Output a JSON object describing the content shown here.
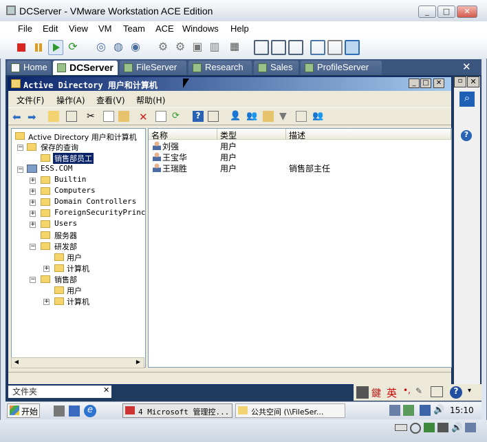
{
  "window": {
    "title": "DCServer - VMware Workstation ACE Edition"
  },
  "menu": [
    "File",
    "Edit",
    "View",
    "VM",
    "Team",
    "ACE",
    "Windows",
    "Help"
  ],
  "tabs": [
    {
      "label": "Home"
    },
    {
      "label": "DCServer"
    },
    {
      "label": "FileServer"
    },
    {
      "label": "Research"
    },
    {
      "label": "Sales"
    },
    {
      "label": "ProfileServer"
    }
  ],
  "mmc": {
    "title": "Active Directory 用户和计算机",
    "menu": [
      "文件(F)",
      "操作(A)",
      "查看(V)",
      "帮助(H)"
    ],
    "tree": [
      "Active Directory 用户和计算机",
      "保存的查询",
      "销售部员工",
      "ESS.COM",
      "Builtin",
      "Computers",
      "Domain Controllers",
      "ForeignSecurityPrincip",
      "Users",
      "服务器",
      "研发部",
      "用户",
      "计算机",
      "销售部",
      "用户",
      "计算机"
    ],
    "columns": [
      "名称",
      "类型",
      "描述"
    ],
    "rows": [
      {
        "name": "刘强",
        "type": "用户",
        "desc": ""
      },
      {
        "name": "王宝华",
        "type": "用户",
        "desc": ""
      },
      {
        "name": "王瑞胜",
        "type": "用户",
        "desc": "销售部主任"
      }
    ]
  },
  "guest_taskbar": {
    "start": "开始",
    "task1": "4 Microsoft 管理控...",
    "task2": "公共空间 (\\\\FileSer...",
    "clock": "15:10",
    "hidden_label": "文件夹"
  },
  "ime": {
    "lang": "英"
  }
}
